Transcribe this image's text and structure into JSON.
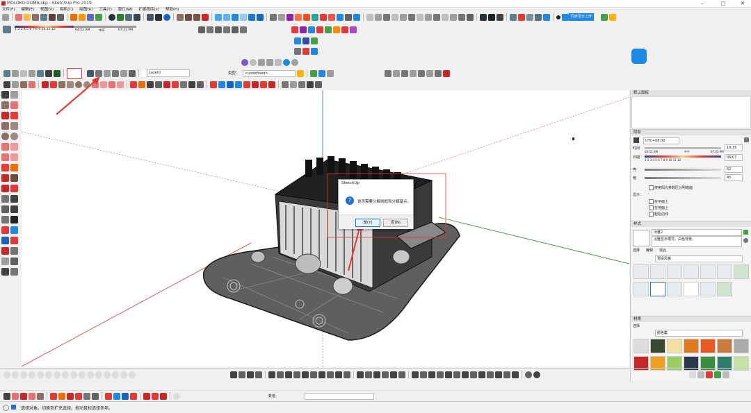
{
  "window": {
    "title": "MOLOKO DOMA.skp - SketchUp Pro 2019",
    "minimize": "–",
    "maximize": "□",
    "close": "✕"
  },
  "menu": [
    "文件(F)",
    "编辑(E)",
    "视图(V)",
    "相机(C)",
    "绘图(R)",
    "工具(T)",
    "窗口(W)",
    "扩展程序(x)",
    "帮助(H)"
  ],
  "shadow_toolbar": {
    "ticks": "1 2 3 4 5 6 7 8 9 10 11 12",
    "start_time": "04:51 AM",
    "noon": "中午",
    "end_time": "07:23 PM"
  },
  "cloud_button": {
    "label": "同步至云上传"
  },
  "layer_toolbar": {
    "layer": "Layer0",
    "type_label": "类型：",
    "type_value": "<undefined>"
  },
  "dialog": {
    "title": "SketchUp",
    "message": "是否需要分解线框和分解基点。",
    "yes": "是(Y)",
    "no": "否(N)"
  },
  "right_panel": {
    "default_panel": "默认面板",
    "shadow_section": "阴影",
    "utc": "UTC+08:00",
    "time_label": "时间",
    "time_value": "19:35",
    "date_label": "日期",
    "date_value": "06/07",
    "panel_start_time": "04:51 AM",
    "panel_noon": "中午",
    "panel_end_time": "07:23 PM",
    "panel_months": "1 2 3 4 5 6 7 8 9 10 11 12",
    "light_label": "亮",
    "light_value": "62",
    "dark_label": "暗",
    "dark_value": "45",
    "use_sun_shading": "使用阳光参数区分明暗面",
    "display_label": "显示：",
    "on_faces": "在平面上",
    "on_ground": "在地面上",
    "from_edges": "起始边线",
    "style_section": "样式",
    "style_name": "淡雅2",
    "style_desc": "淡雅显示模式，白色背景。",
    "style_tabs": [
      "选择",
      "编辑",
      "混合"
    ],
    "style_collection": "预设风格",
    "material_section": "材质",
    "material_tab": "选择",
    "material_collection": "颜色集"
  },
  "bottom_toolbar": {
    "measure_label": "数值"
  },
  "status": {
    "text": "选择对象。切换到扩充选择。拖动鼠标选择多项。"
  },
  "colors": {
    "accent_blue": "#1e6fd9",
    "annotation_red": "#e53935",
    "axis_red": "#d32f2f",
    "axis_green": "#2e7d32",
    "axis_blue": "#1565c0"
  }
}
